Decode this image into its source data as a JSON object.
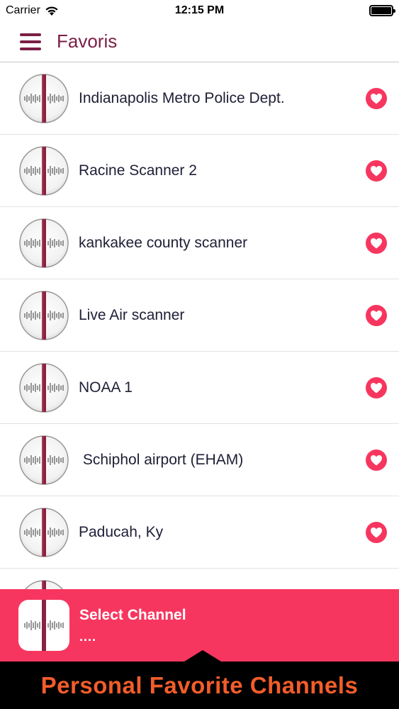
{
  "status_bar": {
    "carrier": "Carrier",
    "time": "12:15 PM",
    "wifi_icon": "wifi-icon",
    "battery_icon": "battery-icon"
  },
  "nav": {
    "menu_icon": "hamburger-menu-icon",
    "title": "Favoris"
  },
  "favorites": [
    {
      "name": "Indianapolis Metro Police Dept."
    },
    {
      "name": "Racine Scanner 2"
    },
    {
      "name": "kankakee county scanner"
    },
    {
      "name": "Live Air scanner"
    },
    {
      "name": "NOAA 1"
    },
    {
      "name": " Schiphol airport (EHAM)"
    },
    {
      "name": "Paducah, Ky"
    }
  ],
  "row_icons": {
    "station": "radio-dial-icon",
    "favorite": "heart-icon"
  },
  "player": {
    "title": "Select Channel",
    "subtitle": "...."
  },
  "promo": {
    "text": "Personal Favorite Channels"
  },
  "colors": {
    "brand": "#7a1f45",
    "accent": "#f7365f",
    "promo_text": "#f25d2a"
  }
}
